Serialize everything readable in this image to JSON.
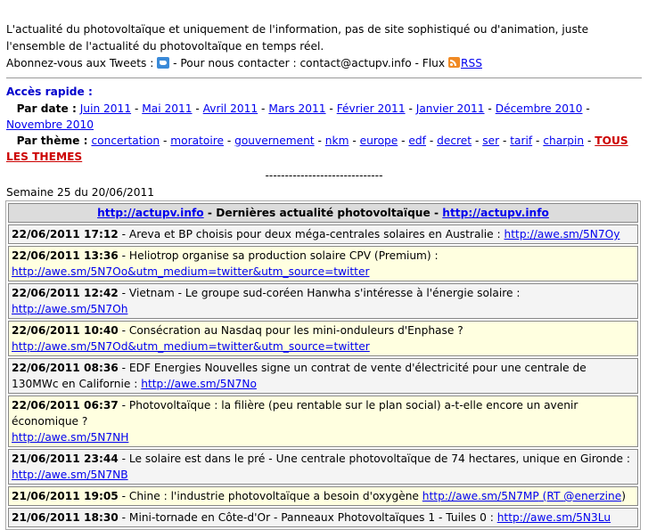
{
  "intro": {
    "line1": "L'actualité du photovoltaïque et uniquement de l'information, pas de site sophistiqué ou d'animation, juste l'ensemble de l'actualité du photovoltaïque en temps réel.",
    "line2_a": "Abonnez-vous aux Tweets : ",
    "line2_b": " - Pour nous contacter : contact@actupv.info - Flux ",
    "rss_label": "RSS"
  },
  "quick": {
    "title": "Accès rapide :",
    "date_label": "Par date :",
    "dates": [
      "Juin 2011",
      "Mai 2011",
      "Avril 2011",
      "Mars 2011",
      "Février 2011",
      "Janvier 2011",
      "Décembre 2010",
      "Novembre 2010"
    ],
    "theme_label": "Par thème :",
    "themes": [
      "concertation",
      "moratoire",
      "gouvernement",
      "nkm",
      "europe",
      "edf",
      "decret",
      "ser",
      "tarif",
      "charpin"
    ],
    "all_themes": "TOUS LES THEMES"
  },
  "dashes": "------------------------------",
  "week": "Semaine 25 du 20/06/2011",
  "feed": {
    "head_link1": "http://actupv.info",
    "head_text": " - Dernières actualité photovoltaïque - ",
    "head_link2": "http://actupv.info",
    "rows": [
      {
        "time": "22/06/2011 17:12",
        "text": " - Areva et BP choisis pour deux méga-centrales solaires en Australie : ",
        "link": "http://awe.sm/5N7Oy",
        "tail": ""
      },
      {
        "time": "22/06/2011 13:36",
        "text": " - Heliotrop organise sa production solaire CPV (Premium) : ",
        "link": "http://awe.sm/5N7Oo&utm_medium=twitter&utm_source=twitter",
        "tail": ""
      },
      {
        "time": "22/06/2011 12:42",
        "text": " - Vietnam - Le groupe sud-coréen Hanwha s'intéresse à l'énergie solaire : ",
        "link": "http://awe.sm/5N7Oh",
        "tail": ""
      },
      {
        "time": "22/06/2011 10:40",
        "text": " - Consécration au Nasdaq pour les mini-onduleurs d'Enphase ? ",
        "link": "http://awe.sm/5N7Od&utm_medium=twitter&utm_source=twitter",
        "tail": ""
      },
      {
        "time": "22/06/2011 08:36",
        "text": " - EDF Energies Nouvelles signe un contrat de vente d'électricité pour une centrale de 130MWc en Californie : ",
        "link": "http://awe.sm/5N7No",
        "tail": ""
      },
      {
        "time": "22/06/2011 06:37",
        "text": " - Photovoltaïque : la filière (peu rentable sur le plan social) a-t-elle encore un avenir économique ? ",
        "link": "http://awe.sm/5N7NH",
        "tail": ""
      },
      {
        "time": "21/06/2011 23:44",
        "text": " - Le solaire est dans le pré - Une centrale photovoltaïque de 74 hectares, unique en Gironde : ",
        "link": "http://awe.sm/5N7NB",
        "tail": ""
      },
      {
        "time": "21/06/2011 19:05",
        "text": " - Chine : l'industrie photovoltaïque a besoin d'oxygène ",
        "link": "http://awe.sm/5N7MP",
        "tail": " (RT ",
        "link2": "@enerzine",
        "tail2": ")"
      },
      {
        "time": "21/06/2011 18:30",
        "text": " - Mini-tornade en Côte-d'Or - Panneaux Photovoltaïques 1 - Tuiles 0 : ",
        "link": "http://awe.sm/5N3Lu",
        "tail": ""
      }
    ]
  }
}
